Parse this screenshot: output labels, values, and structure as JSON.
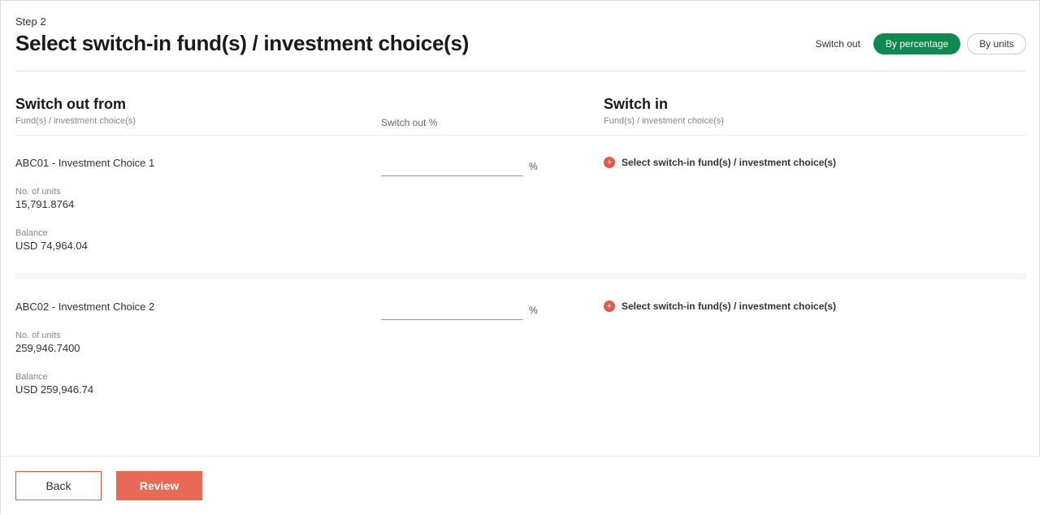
{
  "step_label": "Step 2",
  "title": "Select switch-in fund(s) / investment choice(s)",
  "mode": {
    "switch_out_label": "Switch out",
    "by_percentage": "By percentage",
    "by_units": "By units"
  },
  "columns": {
    "switch_out_title": "Switch out from",
    "switch_out_sub": "Fund(s) / investment choice(s)",
    "switch_out_pct": "Switch out %",
    "switch_in_title": "Switch in",
    "switch_in_sub": "Fund(s) / investment choice(s)"
  },
  "rows": [
    {
      "name": "ABC01 - Investment Choice 1",
      "units_label": "No. of units",
      "units_value": "15,791.8764",
      "balance_label": "Balance",
      "balance_value": "USD 74,964.04",
      "pct_sign": "%",
      "switch_in_link": "Select switch-in fund(s) / investment choice(s)"
    },
    {
      "name": "ABC02 - Investment Choice 2",
      "units_label": "No. of units",
      "units_value": "259,946.7400",
      "balance_label": "Balance",
      "balance_value": "USD 259,946.74",
      "pct_sign": "%",
      "switch_in_link": "Select switch-in fund(s) / investment choice(s)"
    }
  ],
  "buttons": {
    "back": "Back",
    "review": "Review"
  }
}
